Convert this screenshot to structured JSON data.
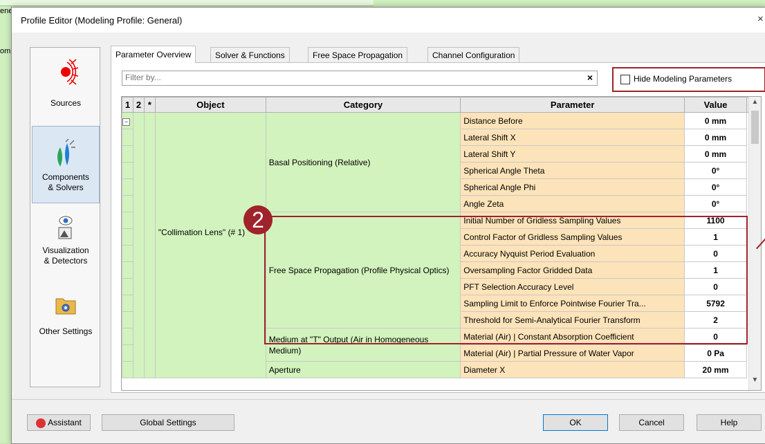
{
  "background_app": {
    "row1_label": "ene",
    "row2_label": "om"
  },
  "dialog": {
    "title": "Profile Editor (Modeling Profile: General)",
    "close_glyph": "×"
  },
  "leftnav": {
    "items": [
      {
        "label_line1": "Sources",
        "label_line2": ""
      },
      {
        "label_line1": "Components",
        "label_line2": "& Solvers"
      },
      {
        "label_line1": "Visualization",
        "label_line2": "& Detectors"
      },
      {
        "label_line1": "Other Settings",
        "label_line2": ""
      }
    ]
  },
  "tabs": [
    "Parameter Overview",
    "Solver & Functions",
    "Free Space Propagation",
    "Channel Configuration"
  ],
  "filter": {
    "placeholder": "Filter by...",
    "clear": "×"
  },
  "hide_modeling": {
    "label": "Hide Modeling Parameters",
    "checked": false
  },
  "grid": {
    "headers": {
      "c1": "1",
      "c2": "2",
      "c3": "*",
      "object": "Object",
      "category": "Category",
      "parameter": "Parameter",
      "value": "Value"
    },
    "object_name": "\"Collimation Lens\" (# 1)",
    "categories": {
      "basal": "Basal Positioning (Relative)",
      "fsp": "Free Space Propagation (Profile Physical Optics)",
      "medium": "Medium at \"T\" Output (Air in Homogeneous Medium)",
      "aperture": "Aperture"
    },
    "rows": [
      {
        "parameter": "Distance Before",
        "value": "0 mm"
      },
      {
        "parameter": "Lateral Shift X",
        "value": "0 mm"
      },
      {
        "parameter": "Lateral Shift Y",
        "value": "0 mm"
      },
      {
        "parameter": "Spherical Angle Theta",
        "value": "0°"
      },
      {
        "parameter": "Spherical Angle Phi",
        "value": "0°"
      },
      {
        "parameter": "Angle Zeta",
        "value": "0°"
      },
      {
        "parameter": "Initial Number of Gridless Sampling Values",
        "value": "1100"
      },
      {
        "parameter": "Control Factor of Gridless Sampling Values",
        "value": "1"
      },
      {
        "parameter": "Accuracy Nyquist Period Evaluation",
        "value": "0"
      },
      {
        "parameter": "Oversampling Factor Gridded Data",
        "value": "1"
      },
      {
        "parameter": "PFT Selection Accuracy Level",
        "value": "0"
      },
      {
        "parameter": "Sampling Limit to Enforce Pointwise Fourier Tra...",
        "value": "5792"
      },
      {
        "parameter": "Threshold for Semi-Analytical Fourier Transform",
        "value": "2"
      },
      {
        "parameter": "Material (Air) | Constant Absorption Coefficient",
        "value": "0"
      },
      {
        "parameter": "Material (Air) | Partial Pressure of Water Vapor",
        "value": "0 Pa"
      },
      {
        "parameter": "Diameter X",
        "value": "20 mm"
      }
    ]
  },
  "annotation": {
    "number": "2"
  },
  "buttons": {
    "assistant": "Assistant",
    "global_settings": "Global Settings",
    "ok": "OK",
    "cancel": "Cancel",
    "help": "Help"
  },
  "colors": {
    "accent_red": "#a0222a",
    "green_cell": "#d2f3bd",
    "orange_cell": "#fde3b9"
  }
}
